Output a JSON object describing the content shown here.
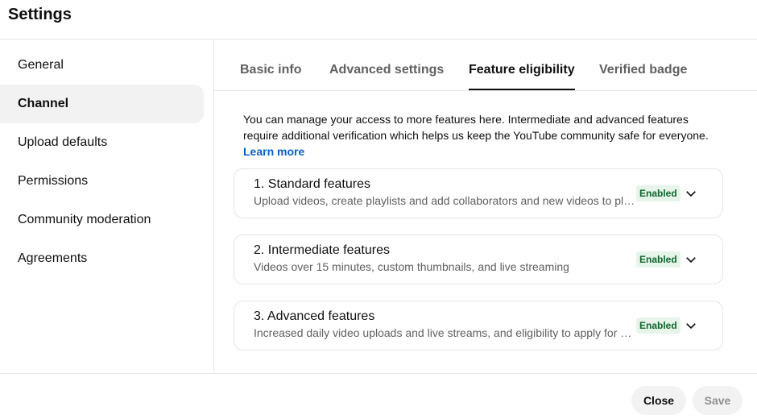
{
  "header": {
    "title": "Settings"
  },
  "sidebar": {
    "items": [
      {
        "label": "General"
      },
      {
        "label": "Channel"
      },
      {
        "label": "Upload defaults"
      },
      {
        "label": "Permissions"
      },
      {
        "label": "Community moderation"
      },
      {
        "label": "Agreements"
      }
    ],
    "active": "Channel"
  },
  "tabs": [
    {
      "label": "Basic info"
    },
    {
      "label": "Advanced settings"
    },
    {
      "label": "Feature eligibility"
    },
    {
      "label": "Verified badge"
    }
  ],
  "active_tab": "Feature eligibility",
  "intro": {
    "text": "You can manage your access to more features here. Intermediate and advanced features require additional verification which helps us keep the YouTube community safe for everyone.",
    "link": "Learn more"
  },
  "features": [
    {
      "title": "1. Standard features",
      "desc": "Upload videos, create playlists and add collaborators and new videos to playlists",
      "status": "Enabled"
    },
    {
      "title": "2. Intermediate features",
      "desc": "Videos over 15 minutes, custom thumbnails, and live streaming",
      "status": "Enabled"
    },
    {
      "title": "3. Advanced features",
      "desc": "Increased daily video uploads and live streams, and eligibility to apply for monetization",
      "status": "Enabled"
    }
  ],
  "footer": {
    "close_label": "Close",
    "save_label": "Save"
  },
  "colors": {
    "link": "#065fd4",
    "badge_bg": "#e6f4ea",
    "badge_text": "#0d652d"
  },
  "icons": {
    "expand": "chevron-down-icon"
  }
}
